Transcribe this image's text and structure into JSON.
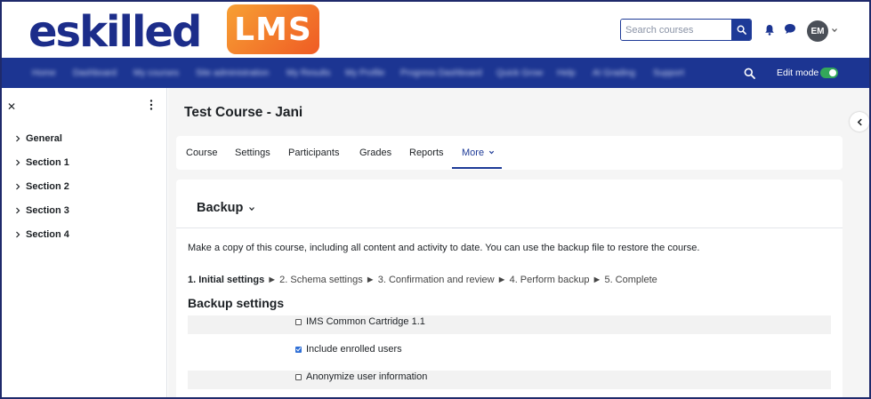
{
  "header": {
    "logo_text": "eskilled",
    "logo_badge": "LMS",
    "search_placeholder": "Search courses",
    "avatar_initials": "EM"
  },
  "navbar": {
    "items": [
      "Home",
      "Dashboard",
      "My courses",
      "Site administration",
      "My Results",
      "My Profile",
      "Progress Dashboard",
      "Quick Grow",
      "Help",
      "AI Grading",
      "Support"
    ],
    "edit_mode_label": "Edit mode",
    "edit_mode_on": true
  },
  "sidebar": {
    "items": [
      "General",
      "Section 1",
      "Section 2",
      "Section 3",
      "Section 4"
    ]
  },
  "main": {
    "course_title": "Test Course - Jani",
    "tabs": [
      "Course",
      "Settings",
      "Participants",
      "Grades",
      "Reports",
      "More"
    ],
    "active_tab": "More",
    "page_heading": "Backup",
    "intro": "Make a copy of this course, including all content and activity to date. You can use the backup file to restore the course.",
    "steps": {
      "current": "1. Initial settings",
      "rest": " ► 2. Schema settings ► 3. Confirmation and review ► 4. Perform backup ► 5. Complete"
    },
    "settings_heading": "Backup settings",
    "settings": [
      {
        "label": "IMS Common Cartridge 1.1",
        "checked": false
      },
      {
        "label": "Include enrolled users",
        "checked": true
      },
      {
        "label": "Anonymize user information",
        "checked": false
      }
    ]
  },
  "colors": {
    "brand_navy": "#1c3592",
    "active_tab": "#1d3a97",
    "toggle_on": "#33a75a",
    "badge_gradient_start": "#f7a034",
    "badge_gradient_end": "#ef5b24"
  }
}
